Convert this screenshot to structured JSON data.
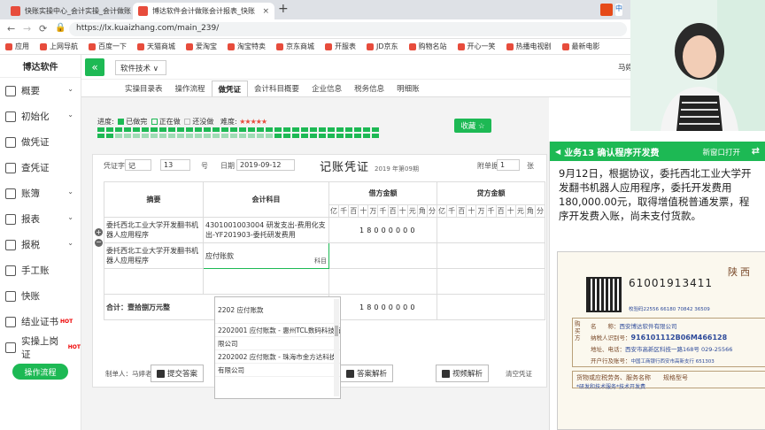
{
  "browser": {
    "tabs": [
      {
        "title": "快账实操中心_会计实操_会计做账",
        "close": "×"
      },
      {
        "title": "博达软件会计做账会计报表_快账",
        "close": "×"
      }
    ],
    "new_tab": "+",
    "url": "https://lx.kuaizhang.com/main_239/",
    "bookmarks": [
      "应用",
      "上网导航",
      "百度一下",
      "天猫商城",
      "爱淘宝",
      "淘宝特卖",
      "京东商城",
      "开服表",
      "JD京东",
      "购物名站",
      "开心一笑",
      "热播电视剧",
      "最新电影"
    ],
    "tray": "中"
  },
  "sidebar": {
    "logo": "博达软件",
    "items": [
      {
        "label": "概要",
        "chevron": true,
        "hot": ""
      },
      {
        "label": "初始化",
        "chevron": true,
        "hot": ""
      },
      {
        "label": "做凭证",
        "chevron": false,
        "hot": ""
      },
      {
        "label": "查凭证",
        "chevron": false,
        "hot": ""
      },
      {
        "label": "账簿",
        "chevron": true,
        "hot": ""
      },
      {
        "label": "报表",
        "chevron": true,
        "hot": ""
      },
      {
        "label": "报税",
        "chevron": true,
        "hot": ""
      },
      {
        "label": "手工账",
        "chevron": false,
        "hot": ""
      },
      {
        "label": "快账",
        "chevron": false,
        "hot": ""
      },
      {
        "label": "结业证书",
        "chevron": false,
        "hot": "HOT"
      },
      {
        "label": "实操上岗证",
        "chevron": false,
        "hot": "HOT"
      }
    ],
    "flow_button": "操作流程"
  },
  "topbar": {
    "collapse": "«",
    "dropdown": "软件技术 ∨",
    "user": "马婷"
  },
  "subtabs": [
    "实操目录表",
    "操作流程",
    "做凭证",
    "会计科目概要",
    "企业信息",
    "税务信息",
    "明细账"
  ],
  "active_subtab": 2,
  "progress": {
    "label": "进度:",
    "done": "已做完",
    "doing": "正在做",
    "todo": "还没做",
    "difficulty": "难度:",
    "stars": "★★★★★",
    "collect": "收藏 ☆",
    "done_count": 22,
    "total": 40
  },
  "voucher": {
    "word_label": "凭证字",
    "word": "记",
    "number": "13",
    "number_unit": "号",
    "date_label": "日期",
    "date": "2019-09-12",
    "title": "记账凭证",
    "period": "2019 年第09期",
    "attach_label": "附单据",
    "attach": "1",
    "attach_unit": "张",
    "col_summary": "摘要",
    "col_account": "会计科目",
    "col_debit": "借方金额",
    "col_credit": "贷方金额",
    "digits": [
      "亿",
      "千",
      "百",
      "十",
      "万",
      "千",
      "百",
      "十",
      "元",
      "角",
      "分"
    ],
    "rows": [
      {
        "summary": "委托西北工业大学开发翻书机器人应用程序",
        "account": "4301001003004 研发支出-费用化支出-YF201903-委托研发费用",
        "debit": "18000000",
        "credit": ""
      },
      {
        "summary": "委托西北工业大学开发翻书机器人应用程序",
        "account": "应付账款",
        "account_hint": "科目",
        "debit": "",
        "credit": ""
      },
      {
        "summary": "",
        "account": "",
        "debit": "",
        "credit": ""
      }
    ],
    "total_label": "合计：壹拾捌万元整",
    "total_debit": "18000000",
    "maker": "制单人：马婷老师",
    "clear": "清空凭证",
    "dropdown_items": [
      "2202 应付账款",
      "2202001 应付账款 - 惠州TCL数码科技有",
      "限公司",
      "2202002 应付账款 - 珠海市金方达科技",
      "有限公司"
    ]
  },
  "actions": [
    "提交答案",
    "查看答案",
    "答案解析",
    "视频解析"
  ],
  "task": {
    "title": "业务13 确认程序开发费",
    "new_window": "新窗口打开",
    "switch": "⇄",
    "text": "9月12日，根据协议，委托西北工业大学开发翻书机器人应用程序，委托开发费用180,000.00元，取得增值税普通发票，程序开发费入账，尚未支付货款。"
  },
  "invoice": {
    "number": "61001913411",
    "code": "校验码22556 66180 70842 36509",
    "brand": "陕西",
    "side": "购买方",
    "buyer_name_label": "名　　称：",
    "buyer_name": "西安博达软件有限公司",
    "tax_id_label": "纳税人识别号：",
    "tax_id": "916101112B06M466128",
    "addr_label": "地址、电话：",
    "addr": "西安市高新区科技一路168号 029-25566",
    "bank_label": "开户行及账号：",
    "bank": "中国工商银行西安市高新支行 651303",
    "goods": "货物或应税劳务、服务名称　　规格型号",
    "goods_item": "*研发和技术服务*技术开发费"
  },
  "colors": {
    "accent": "#1db954",
    "text": "#333333"
  }
}
